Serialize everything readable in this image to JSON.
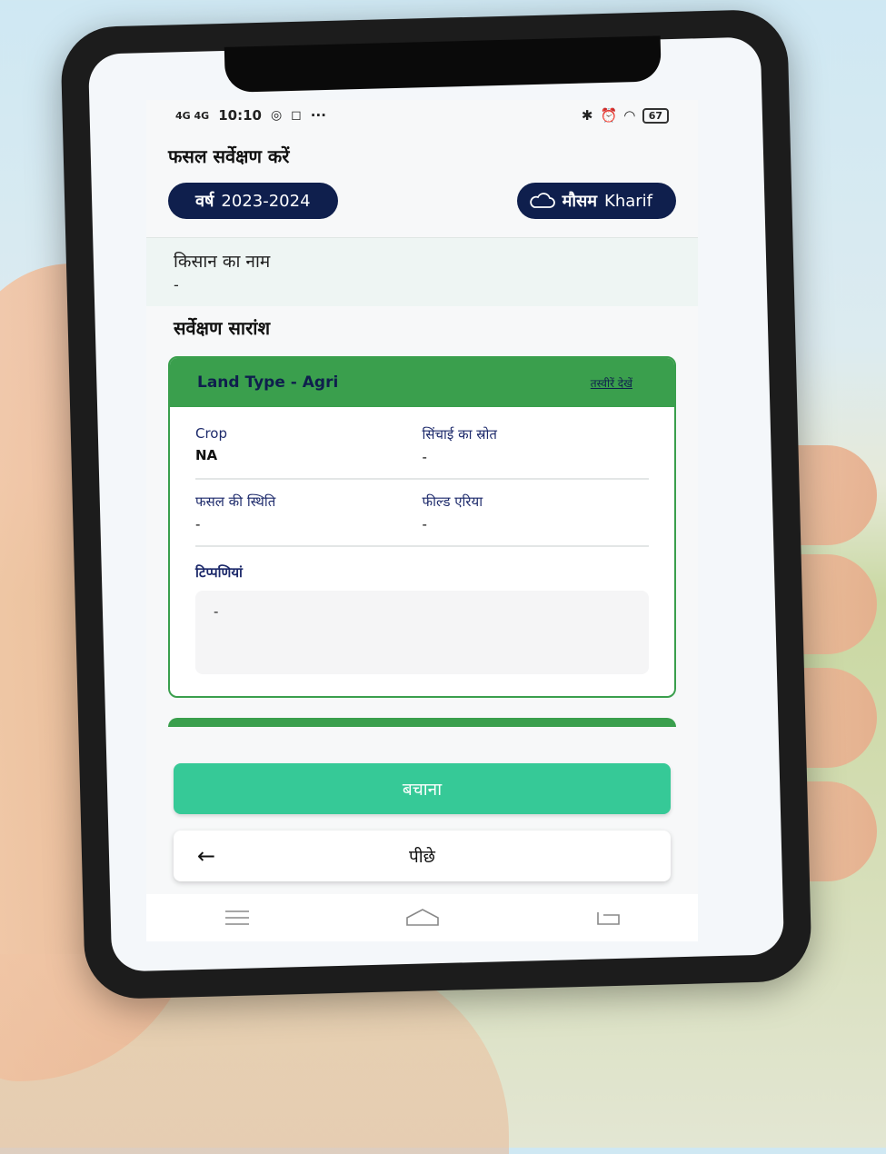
{
  "status_bar": {
    "network": "4G 4G",
    "time": "10:10",
    "battery": "67"
  },
  "page": {
    "title": "फसल सर्वेक्षण करें"
  },
  "filters": {
    "year_label": "वर्ष",
    "year_value": "2023-2024",
    "season_label": "मौसम",
    "season_value": "Kharif"
  },
  "farmer": {
    "label": "किसान का नाम",
    "value": "-"
  },
  "summary": {
    "title": "सर्वेक्षण सारांश",
    "card": {
      "heading": "Land Type - Agri",
      "view_images_link": "तस्वीरें देखें",
      "crop_label": "Crop",
      "crop_value": "NA",
      "irrigation_label": "सिंचाई का स्रोत",
      "irrigation_value": "-",
      "crop_status_label": "फसल की स्थिति",
      "crop_status_value": "-",
      "field_area_label": "फील्ड एरिया",
      "field_area_value": "-",
      "remarks_label": "टिप्पणियां",
      "remarks_value": "-"
    }
  },
  "actions": {
    "save_label": "बचाना",
    "back_label": "पीछे"
  },
  "colors": {
    "navy": "#0f1f4d",
    "green_header": "#3a9f4d",
    "save_button": "#36c997"
  }
}
